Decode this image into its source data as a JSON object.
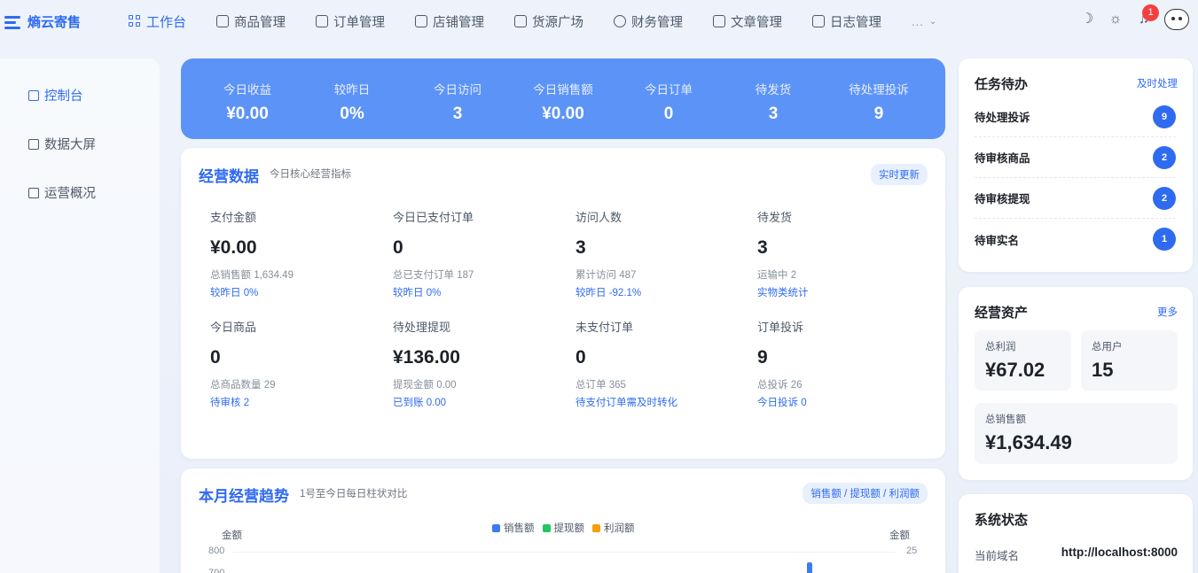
{
  "app": {
    "name": "熵云寄售"
  },
  "nav": {
    "items": [
      {
        "label": "工作台",
        "icon": "dashboard-icon"
      },
      {
        "label": "商品管理",
        "icon": "bag-icon"
      },
      {
        "label": "订单管理",
        "icon": "list-icon"
      },
      {
        "label": "店铺管理",
        "icon": "store-icon"
      },
      {
        "label": "货源广场",
        "icon": "shop-icon"
      },
      {
        "label": "财务管理",
        "icon": "coin-icon"
      },
      {
        "label": "文章管理",
        "icon": "article-icon"
      },
      {
        "label": "日志管理",
        "icon": "log-icon"
      }
    ],
    "more": "..."
  },
  "header": {
    "notification_count": "1"
  },
  "sidebar": {
    "items": [
      {
        "label": "控制台"
      },
      {
        "label": "数据大屏"
      },
      {
        "label": "运营概况"
      }
    ]
  },
  "banner": {
    "stats": [
      {
        "label": "今日收益",
        "value": "¥0.00"
      },
      {
        "label": "较昨日",
        "value": "0%"
      },
      {
        "label": "今日访问",
        "value": "3"
      },
      {
        "label": "今日销售额",
        "value": "¥0.00"
      },
      {
        "label": "今日订单",
        "value": "0"
      },
      {
        "label": "待发货",
        "value": "3"
      },
      {
        "label": "待处理投诉",
        "value": "9"
      }
    ]
  },
  "business": {
    "title": "经营数据",
    "subtitle": "今日核心经营指标",
    "realtime": "实时更新",
    "metrics": [
      {
        "label": "支付金额",
        "value": "¥0.00",
        "sub": "总销售额 1,634.49",
        "link": "较昨日 0%"
      },
      {
        "label": "今日已支付订单",
        "value": "0",
        "sub": "总已支付订单 187",
        "link": "较昨日 0%"
      },
      {
        "label": "访问人数",
        "value": "3",
        "sub": "累计访问 487",
        "link": "较昨日 -92.1%"
      },
      {
        "label": "待发货",
        "value": "3",
        "sub": "运输中 2",
        "link": "实物类统计"
      },
      {
        "label": "今日商品",
        "value": "0",
        "sub": "总商品数量 29",
        "link": "待审核 2"
      },
      {
        "label": "待处理提现",
        "value": "¥136.00",
        "sub": "提现金额 0.00",
        "link": "已到账 0.00"
      },
      {
        "label": "未支付订单",
        "value": "0",
        "sub": "总订单 365",
        "link": "待支付订单需及时转化"
      },
      {
        "label": "订单投诉",
        "value": "9",
        "sub": "总投诉 26",
        "link": "今日投诉 0"
      }
    ]
  },
  "trend": {
    "title": "本月经营趋势",
    "subtitle": "1号至今日每日柱状对比",
    "pill": "销售额 / 提现额 / 利润额",
    "legend": [
      {
        "name": "销售额",
        "color": "#3b7cf0"
      },
      {
        "name": "提现额",
        "color": "#22c55e"
      },
      {
        "name": "利润额",
        "color": "#f59e0b"
      }
    ],
    "y_left_label": "金额",
    "y_right_label": "金额",
    "left_ticks": [
      "800",
      "700"
    ],
    "right_ticks": [
      "25"
    ]
  },
  "chart_data": {
    "type": "bar",
    "title": "本月经营趋势",
    "series": [
      {
        "name": "销售额",
        "values": []
      },
      {
        "name": "提现额",
        "values": []
      },
      {
        "name": "利润额",
        "values": []
      }
    ],
    "ylabel": "金额",
    "y2label": "金额",
    "y_ticks_visible": [
      800,
      700
    ],
    "y2_ticks_visible": [
      25
    ],
    "legend_position": "top-center",
    "grid": true
  },
  "tasks": {
    "title": "任务待办",
    "link": "及时处理",
    "items": [
      {
        "label": "待处理投诉",
        "count": "9"
      },
      {
        "label": "待审核商品",
        "count": "2"
      },
      {
        "label": "待审核提现",
        "count": "2"
      },
      {
        "label": "待审实名",
        "count": "1"
      }
    ]
  },
  "assets": {
    "title": "经营资产",
    "link": "更多",
    "items": [
      {
        "label": "总利润",
        "value": "¥67.02"
      },
      {
        "label": "总用户",
        "value": "15"
      },
      {
        "label": "总销售额",
        "value": "¥1,634.49"
      }
    ]
  },
  "system": {
    "title": "系统状态",
    "domain_label": "当前域名",
    "domain_value": "http://localhost:8000"
  }
}
